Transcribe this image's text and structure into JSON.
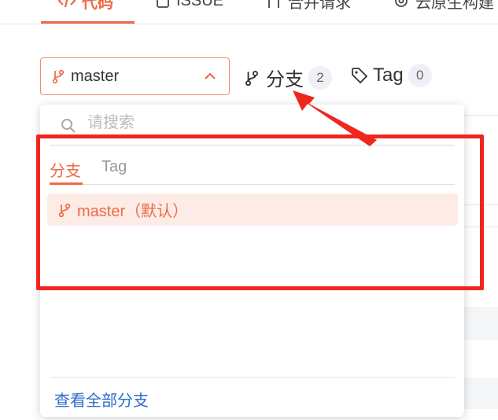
{
  "top_tabs": {
    "code": "代码",
    "issue": "ISSUE",
    "merge": "合并请求",
    "cloud": "云原生构建"
  },
  "branch_select": {
    "value": "master"
  },
  "stats": {
    "branch_label": "分支",
    "branch_count": "2",
    "tag_label": "Tag",
    "tag_count": "0"
  },
  "dropdown": {
    "search_placeholder": "请搜索",
    "tabs": [
      "分支",
      "Tag"
    ],
    "items": [
      {
        "label": "master（默认）"
      }
    ],
    "view_all": "查看全部分支"
  },
  "colors": {
    "accent": "#ee6a45",
    "link": "#2e6ccc",
    "annotation": "#f0261e"
  }
}
